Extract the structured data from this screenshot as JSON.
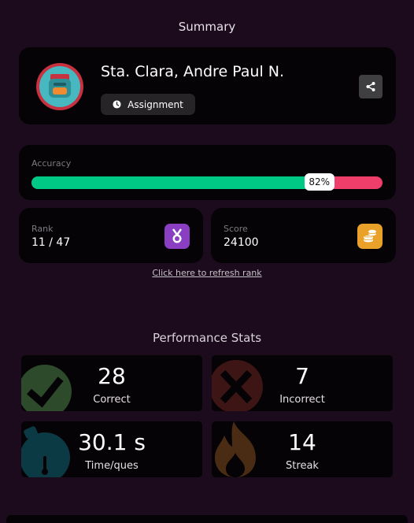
{
  "summary": {
    "title": "Summary"
  },
  "profile": {
    "name": "Sta. Clara, Andre Paul N.",
    "mode_label": "Assignment"
  },
  "accuracy": {
    "label": "Accuracy",
    "percent": 82,
    "percent_label": "82%"
  },
  "rank": {
    "label": "Rank",
    "value": "11 / 47"
  },
  "score": {
    "label": "Score",
    "value": "24100"
  },
  "refresh": {
    "link_text": "Click here to refresh rank"
  },
  "performance": {
    "title": "Performance Stats",
    "stats": [
      {
        "value": "28",
        "label": "Correct",
        "icon": "check-icon",
        "color": "#2d4a2b"
      },
      {
        "value": "7",
        "label": "Incorrect",
        "icon": "cross-icon",
        "color": "#3e1515"
      },
      {
        "value": "30.1 s",
        "label": "Time/ques",
        "icon": "stopwatch-icon",
        "color": "#0c3a44"
      },
      {
        "value": "14",
        "label": "Streak",
        "icon": "fire-icon",
        "color": "#4a2c14"
      }
    ]
  },
  "colors": {
    "background": "#1c0b1d",
    "card": "#050305",
    "accuracy_correct": "#00c985",
    "accuracy_incorrect": "#ef3e6a",
    "rank_badge": "#8a3fc2",
    "score_badge": "#e9a12a"
  }
}
